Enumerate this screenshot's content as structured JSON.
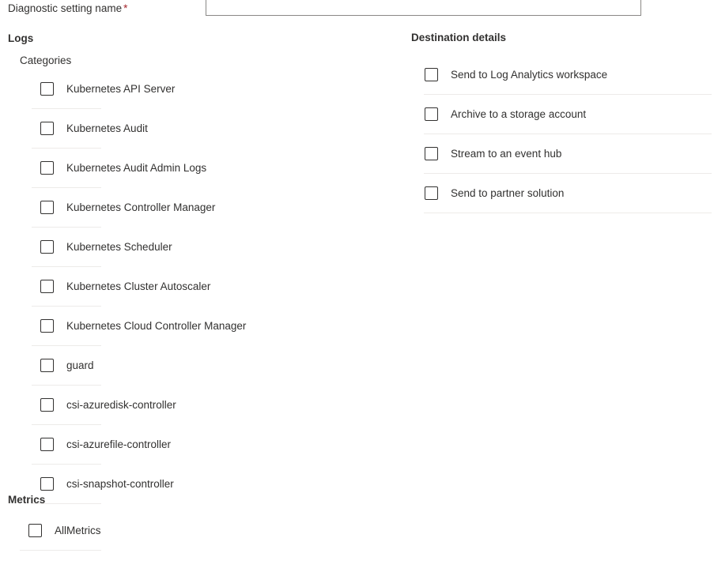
{
  "form": {
    "name_label": "Diagnostic setting name",
    "required_marker": "*",
    "name_value": "",
    "name_placeholder": ""
  },
  "logs": {
    "section_title": "Logs",
    "categories_label": "Categories",
    "categories": [
      {
        "label": "Kubernetes API Server",
        "checked": false
      },
      {
        "label": "Kubernetes Audit",
        "checked": false
      },
      {
        "label": "Kubernetes Audit Admin Logs",
        "checked": false
      },
      {
        "label": "Kubernetes Controller Manager",
        "checked": false
      },
      {
        "label": "Kubernetes Scheduler",
        "checked": false
      },
      {
        "label": "Kubernetes Cluster Autoscaler",
        "checked": false
      },
      {
        "label": "Kubernetes Cloud Controller Manager",
        "checked": false
      },
      {
        "label": "guard",
        "checked": false
      },
      {
        "label": "csi-azuredisk-controller",
        "checked": false
      },
      {
        "label": "csi-azurefile-controller",
        "checked": false
      },
      {
        "label": "csi-snapshot-controller",
        "checked": false
      }
    ]
  },
  "metrics": {
    "section_title": "Metrics",
    "items": [
      {
        "label": "AllMetrics",
        "checked": false
      }
    ]
  },
  "destination": {
    "section_title": "Destination details",
    "options": [
      {
        "label": "Send to Log Analytics workspace",
        "checked": false
      },
      {
        "label": "Archive to a storage account",
        "checked": false
      },
      {
        "label": "Stream to an event hub",
        "checked": false
      },
      {
        "label": "Send to partner solution",
        "checked": false
      }
    ]
  },
  "colors": {
    "required_asterisk": "#a4262c",
    "text": "#323130",
    "divider": "#edebe9",
    "input_border": "#8a8886",
    "accent": "#0078d4"
  }
}
